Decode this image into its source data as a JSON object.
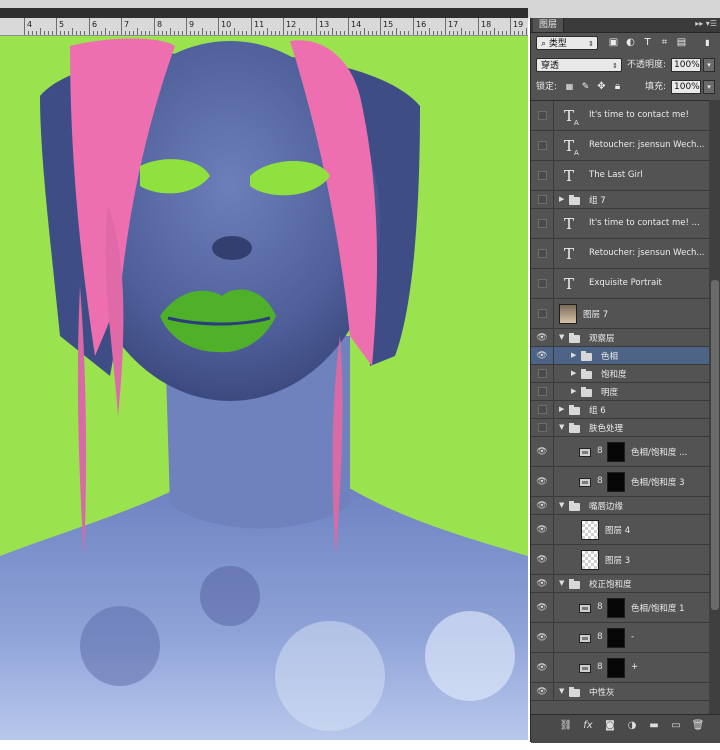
{
  "ruler": {
    "numbers": [
      "4",
      "5",
      "6",
      "7",
      "8",
      "9",
      "10",
      "11",
      "12",
      "13",
      "14",
      "15",
      "16",
      "17",
      "18",
      "19"
    ]
  },
  "panel": {
    "tab": "图层",
    "filter": {
      "label": "类型",
      "icon_names": [
        "image-filter-icon",
        "adjustment-filter-icon",
        "type-filter-icon",
        "shape-filter-icon",
        "smart-object-filter-icon"
      ]
    },
    "blend_mode": "穿透",
    "opacity_label": "不透明度:",
    "opacity_value": "100%",
    "lock_label": "锁定:",
    "fill_label": "填充:",
    "fill_value": "100%"
  },
  "layers": [
    {
      "name": "It's time to contact me!",
      "type": "text-warp",
      "visible": false,
      "indent": 0
    },
    {
      "name": "Retoucher: jsensun Wech...",
      "type": "text-warp",
      "visible": false,
      "indent": 0
    },
    {
      "name": "The Last Girl",
      "type": "text",
      "visible": false,
      "indent": 0
    },
    {
      "name": "组 7",
      "type": "group",
      "expanded": false,
      "visible": false,
      "indent": 0
    },
    {
      "name": "It's time to contact me! ...",
      "type": "text",
      "visible": false,
      "indent": 0
    },
    {
      "name": "Retoucher: jsensun Wech...",
      "type": "text",
      "visible": false,
      "indent": 0
    },
    {
      "name": "Exquisite Portrait",
      "type": "text",
      "visible": false,
      "indent": 0
    },
    {
      "name": "图层 7",
      "type": "image",
      "visible": false,
      "indent": 0
    },
    {
      "name": "观察层",
      "type": "group",
      "expanded": true,
      "visible": true,
      "indent": 0
    },
    {
      "name": "色相",
      "type": "group",
      "expanded": false,
      "visible": true,
      "indent": 1,
      "selected": true
    },
    {
      "name": "饱和度",
      "type": "group",
      "expanded": false,
      "visible": false,
      "indent": 1
    },
    {
      "name": "明度",
      "type": "group",
      "expanded": false,
      "visible": false,
      "indent": 1
    },
    {
      "name": "组 6",
      "type": "group",
      "expanded": false,
      "visible": false,
      "indent": 0
    },
    {
      "name": "肤色处理",
      "type": "group",
      "expanded": true,
      "visible": false,
      "indent": 0
    },
    {
      "name": "色相/饱和度 ...",
      "type": "adjustment",
      "visible": true,
      "indent": 1
    },
    {
      "name": "色相/饱和度 3",
      "type": "adjustment",
      "visible": true,
      "indent": 1
    },
    {
      "name": "嘴唇边缘",
      "type": "group",
      "expanded": true,
      "visible": true,
      "indent": 0
    },
    {
      "name": "图层 4",
      "type": "pixel",
      "visible": true,
      "indent": 1
    },
    {
      "name": "图层 3",
      "type": "pixel",
      "visible": true,
      "indent": 1
    },
    {
      "name": "校正饱和度",
      "type": "group",
      "expanded": true,
      "visible": true,
      "indent": 0
    },
    {
      "name": "色相/饱和度 1",
      "type": "adjustment",
      "visible": true,
      "indent": 1
    },
    {
      "name": "-",
      "type": "adjustment",
      "visible": true,
      "indent": 1
    },
    {
      "name": "+",
      "type": "adjustment",
      "visible": true,
      "indent": 1
    },
    {
      "name": "中性灰",
      "type": "group",
      "expanded": true,
      "visible": true,
      "indent": 0
    }
  ],
  "footer_icons": [
    "link-icon",
    "fx-icon",
    "mask-icon",
    "adjustment-icon",
    "folder-icon",
    "new-layer-icon",
    "trash-icon"
  ],
  "colors": {
    "canvas_bg": "#9be24f",
    "panel_bg": "#535353",
    "selected_row": "#4d6486",
    "hair": "#ee6fb0",
    "lips": "#4fb02a",
    "skin": "#5f6fa8"
  }
}
